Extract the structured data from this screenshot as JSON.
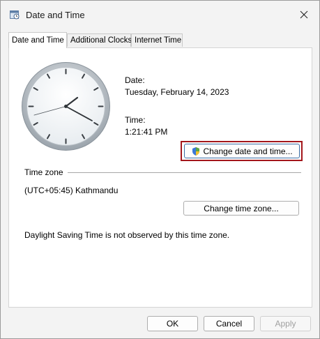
{
  "window": {
    "title": "Date and Time",
    "icon": "clock-calendar-icon"
  },
  "tabs": [
    {
      "label": "Date and Time",
      "active": true
    },
    {
      "label": "Additional Clocks",
      "active": false
    },
    {
      "label": "Internet Time",
      "active": false
    }
  ],
  "date": {
    "label": "Date:",
    "value": "Tuesday, February 14, 2023"
  },
  "time": {
    "label": "Time:",
    "value": "1:21:41 PM"
  },
  "change_datetime_button": {
    "label": "Change date and time...",
    "icon": "shield-uac-icon"
  },
  "timezone": {
    "heading": "Time zone",
    "value": "(UTC+05:45) Kathmandu",
    "change_button": "Change time zone..."
  },
  "dst_note": "Daylight Saving Time is not observed by this time zone.",
  "footer": {
    "ok": "OK",
    "cancel": "Cancel",
    "apply": "Apply"
  },
  "colors": {
    "highlight_border": "#a3161b",
    "window_bg": "#f3f3f3",
    "panel_bg": "#ffffff"
  }
}
